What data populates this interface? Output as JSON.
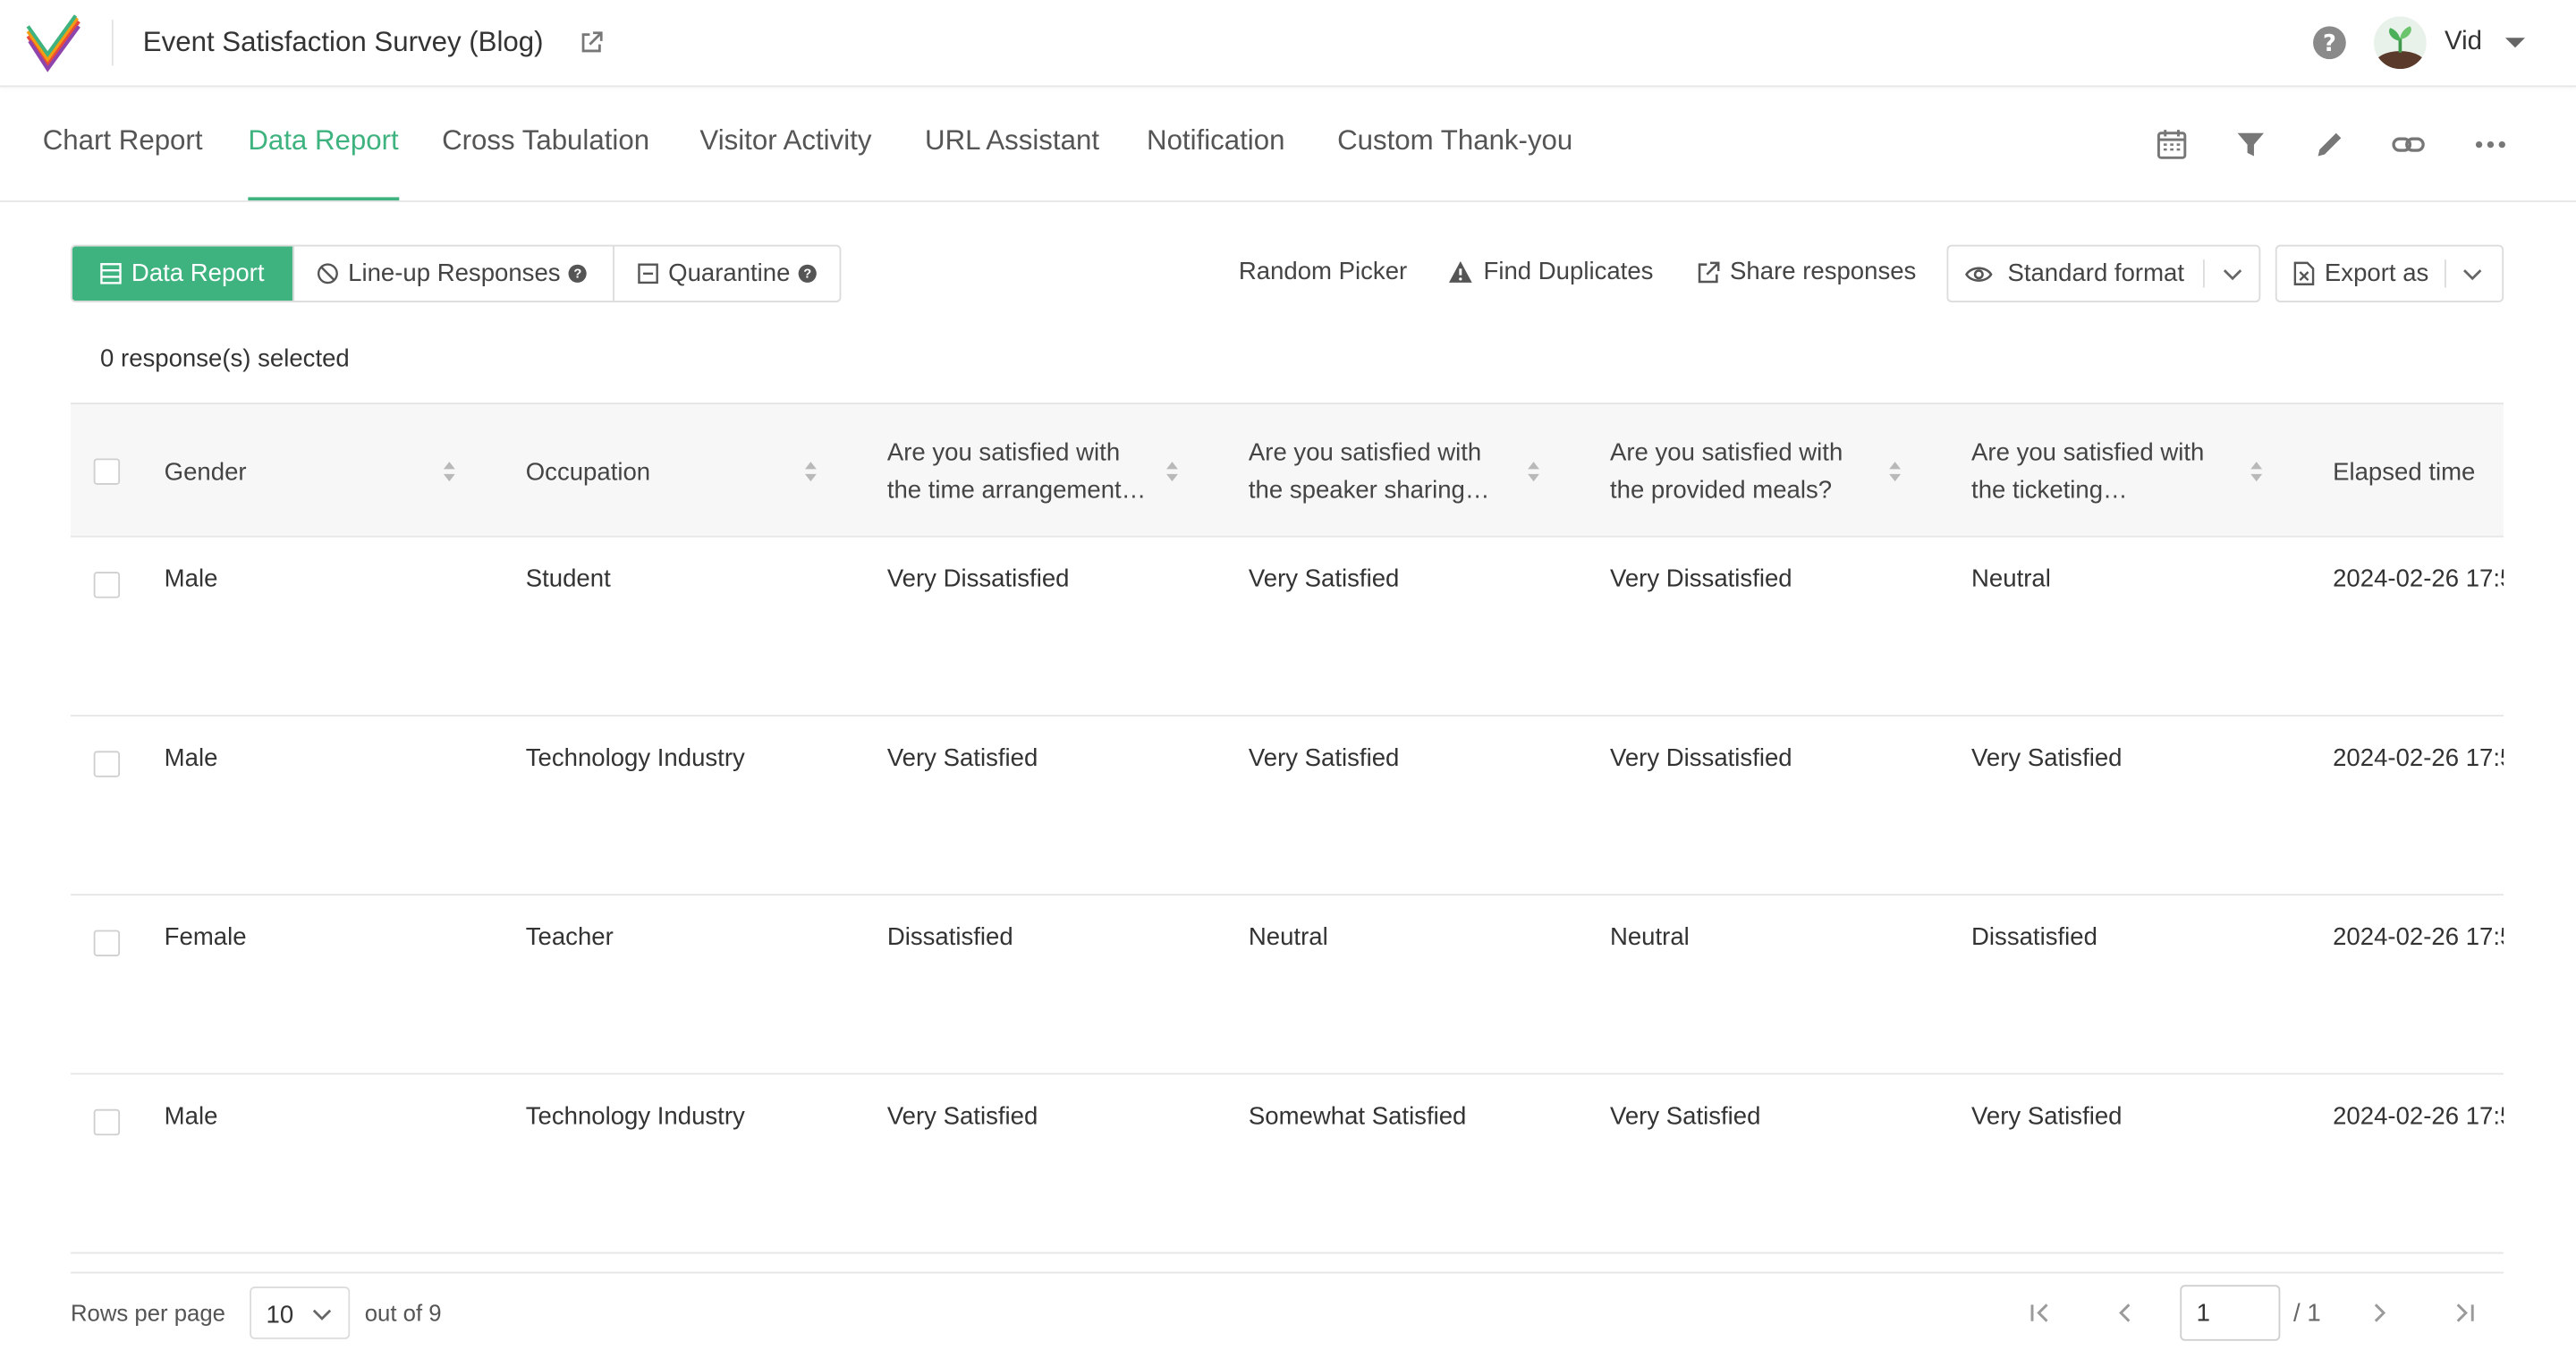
{
  "header": {
    "survey_title": "Event Satisfaction Survey (Blog)",
    "user_name": "Vid"
  },
  "tabs": [
    {
      "label": "Chart Report"
    },
    {
      "label": "Data Report",
      "active": true
    },
    {
      "label": "Cross Tabulation"
    },
    {
      "label": "Visitor Activity"
    },
    {
      "label": "URL Assistant"
    },
    {
      "label": "Notification"
    },
    {
      "label": "Custom Thank-you"
    }
  ],
  "tool_icons": [
    "calendar-icon",
    "filter-icon",
    "pencil-icon",
    "link-icon",
    "more-icon"
  ],
  "toolbar": {
    "segments": [
      {
        "label": "Data Report",
        "icon": "table-icon",
        "active": true
      },
      {
        "label": "Line-up Responses",
        "icon": "ban-icon",
        "help": "?"
      },
      {
        "label": "Quarantine",
        "icon": "quarantine-icon",
        "help": "?"
      }
    ],
    "random_picker": "Random Picker",
    "find_duplicates": "Find Duplicates",
    "share_responses": "Share responses",
    "format_label": "Standard format",
    "export_label": "Export as"
  },
  "selection": {
    "summary": "0 response(s) selected"
  },
  "table": {
    "columns": [
      {
        "line1": "Gender",
        "line2": ""
      },
      {
        "line1": "Occupation",
        "line2": ""
      },
      {
        "line1": "Are you satisfied with",
        "line2": "the time arrangement…"
      },
      {
        "line1": "Are you satisfied with",
        "line2": "the speaker sharing…"
      },
      {
        "line1": "Are you satisfied with",
        "line2": "the provided meals?"
      },
      {
        "line1": "Are you satisfied with",
        "line2": "the ticketing…"
      },
      {
        "line1": "Elapsed time",
        "line2": ""
      }
    ],
    "rows": [
      [
        "Male",
        "Student",
        "Very Dissatisfied",
        "Very Satisfied",
        "Very Dissatisfied",
        "Neutral",
        "2024-02-26 17:5"
      ],
      [
        "Male",
        "Technology Industry",
        "Very Satisfied",
        "Very Satisfied",
        "Very Dissatisfied",
        "Very Satisfied",
        "2024-02-26 17:5"
      ],
      [
        "Female",
        "Teacher",
        "Dissatisfied",
        "Neutral",
        "Neutral",
        "Dissatisfied",
        "2024-02-26 17:5"
      ],
      [
        "Male",
        "Technology Industry",
        "Very Satisfied",
        "Somewhat Satisfied",
        "Very Satisfied",
        "Very Satisfied",
        "2024-02-26 17:5"
      ]
    ]
  },
  "pagination": {
    "rows_per_page_label": "Rows per page",
    "rows_per_page_value": "10",
    "out_of": "out of 9",
    "page_value": "1",
    "page_total": "/ 1"
  },
  "colors": {
    "accent": "#3fb37f"
  }
}
